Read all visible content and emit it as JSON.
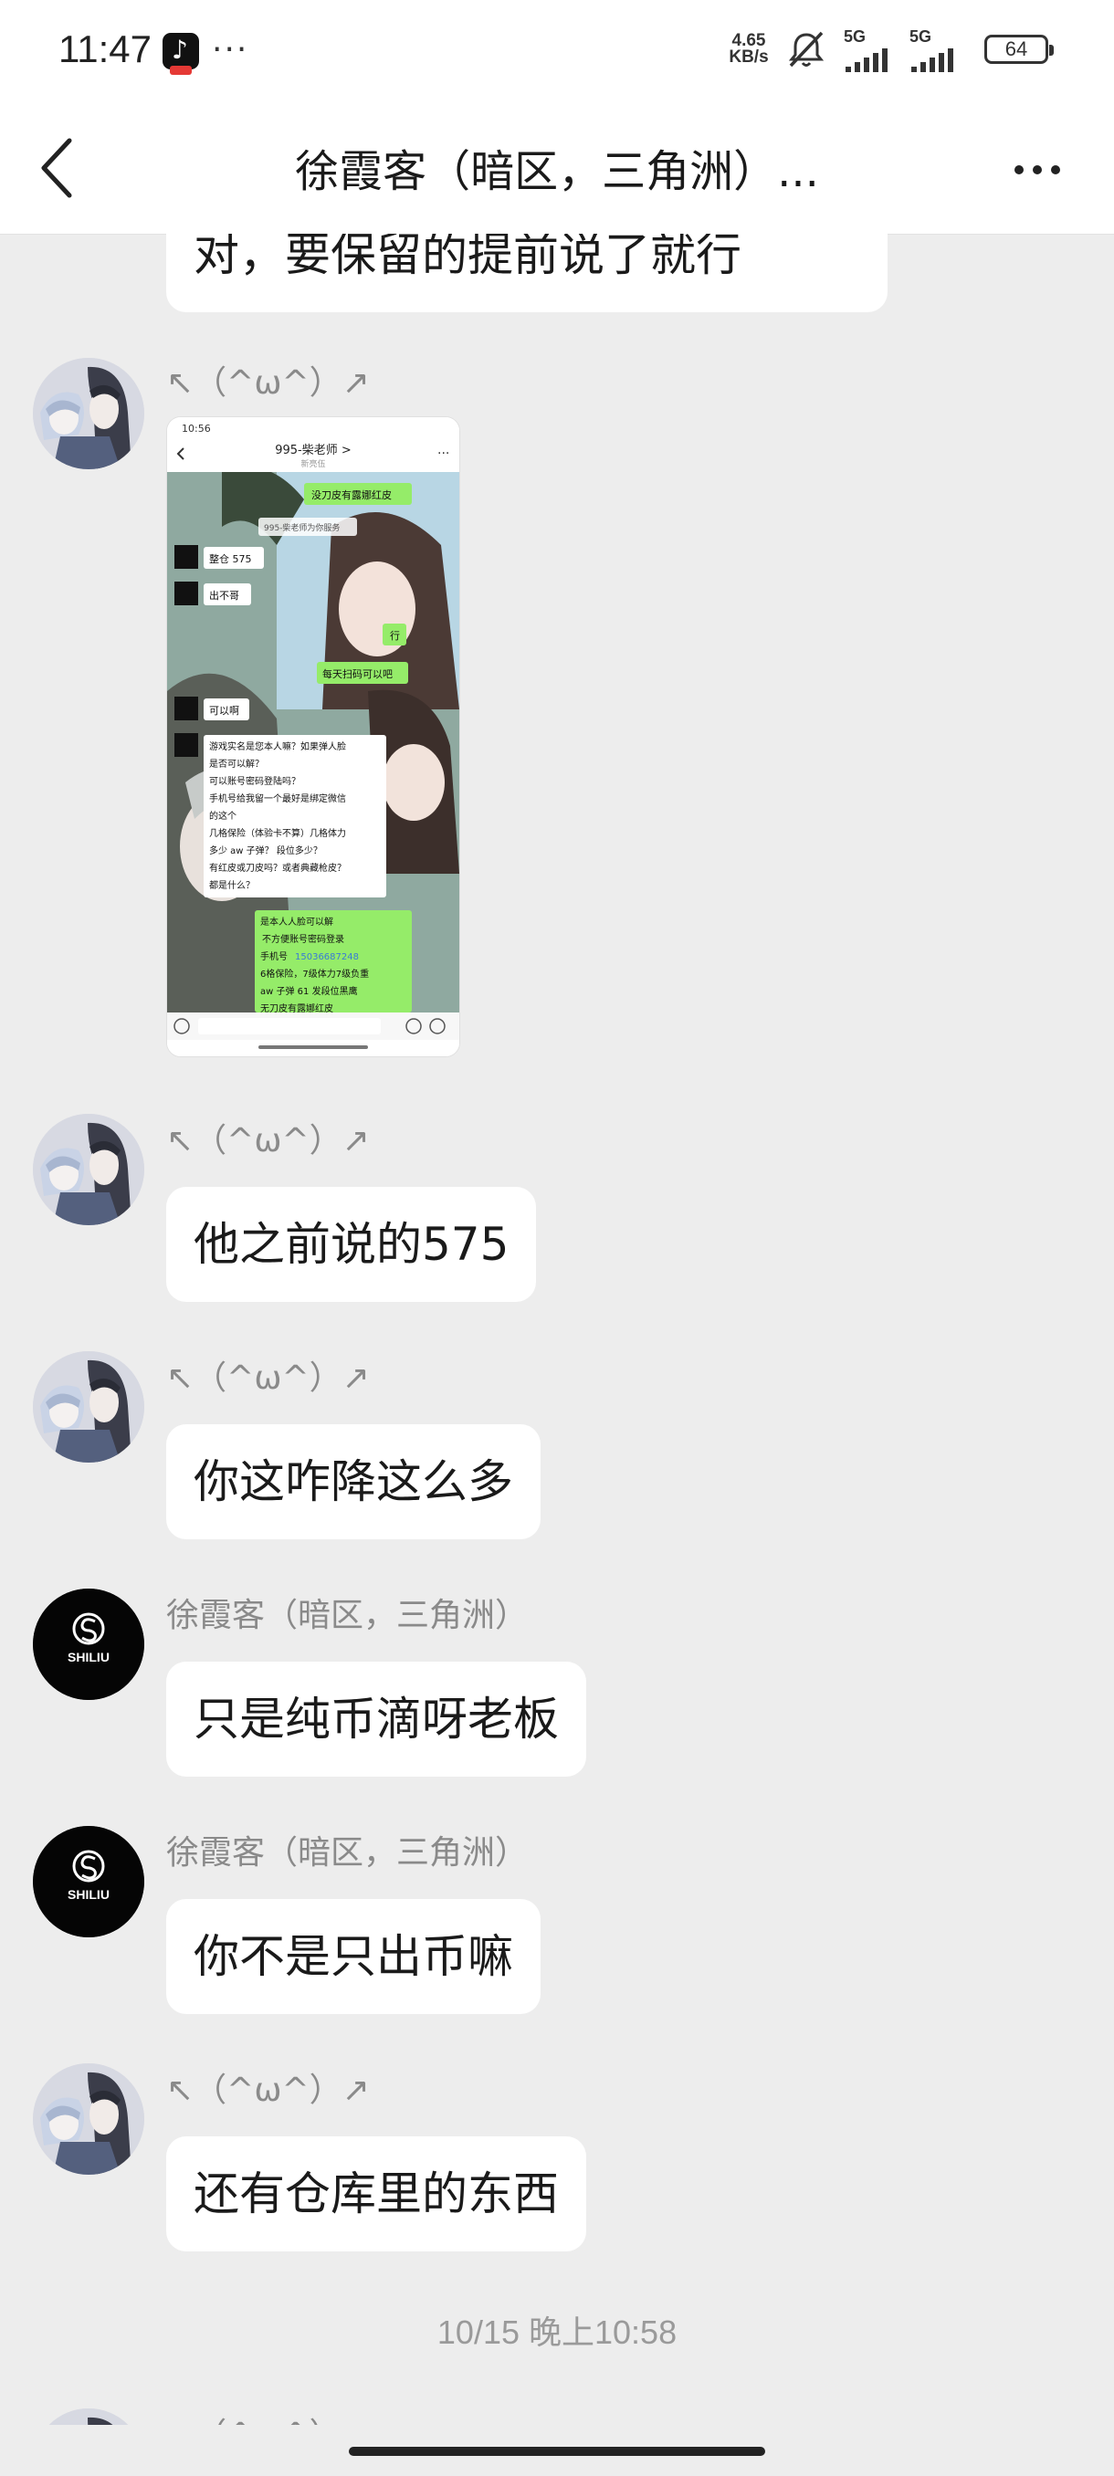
{
  "status_bar": {
    "time": "11:47",
    "more": "···",
    "net_speed": "4.65\nKB/s",
    "sim1": "5G",
    "sim2": "5G",
    "battery": "64"
  },
  "header": {
    "title": "徐霞客（暗区，三角洲）..."
  },
  "messages": {
    "m0": {
      "text": "对，要保留的提前说了就行"
    },
    "m1": {
      "sender": "↖（^ω^）↗"
    },
    "m1_shot": {
      "time": "10:56",
      "title": "995-柴老师 >",
      "subtitle": "新亮伍",
      "lines": {
        "a": "没刀皮有露娜红皮",
        "b": "995-柴老师为你服务",
        "c": "整仓 575",
        "d": "出不哥",
        "e": "行",
        "f": "每天扫码可以吧",
        "g": "可以啊",
        "h1": "游戏实名是您本人嘛？如果弹人脸",
        "h2": "是否可以解？",
        "h3": "可以账号密码登陆吗？",
        "h4": "手机号给我留一个最好是绑定微信",
        "h5": "的这个",
        "h6": "几格保险（体验卡不算）几格体力",
        "h7": "多少 aw 子弹？ 段位多少？",
        "h8": "有红皮或刀皮吗？或者典藏枪皮？",
        "h9": "都是什么？",
        "i1": "是本人人脸可以解",
        "i2": "不方便账号密码登录",
        "i3": "手机号",
        "i3b": "15036687248",
        "i4": "6格保险，7级体力7级负重",
        "i5": "aw 子弹 61 发段位黑鹰",
        "i6": "无刀皮有露娜红皮"
      }
    },
    "m2": {
      "sender": "↖（^ω^）↗",
      "text": "他之前说的575"
    },
    "m3": {
      "sender": "↖（^ω^）↗",
      "text": "你这咋降这么多"
    },
    "m4": {
      "sender": "徐霞客（暗区，三角洲）",
      "text": "只是纯币滴呀老板"
    },
    "m5": {
      "sender": "徐霞客（暗区，三角洲）",
      "text": "你不是只出币嘛"
    },
    "m6": {
      "sender": "↖（^ω^）↗",
      "text": "还有仓库里的东西"
    },
    "timestamp": "10/15 晚上10:58",
    "m7": {
      "sender": "↖（^ω^）↗"
    }
  },
  "logo": {
    "text": "SHILIU"
  },
  "colors": {
    "background": "#ededed",
    "bubble": "#ffffff",
    "wechat_green": "#95ec69"
  },
  "icons": [
    "back-arrow-icon",
    "more-dots-icon",
    "mute-icon",
    "signal-icon",
    "battery-icon"
  ]
}
